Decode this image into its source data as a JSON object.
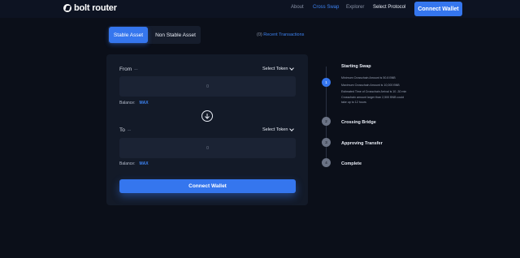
{
  "header": {
    "logo_text": "bolt router",
    "nav": {
      "about": "About",
      "cross_swap": "Cross Swap",
      "explorer": "Explorer",
      "select_protocol": "Select Protocol"
    },
    "connect_wallet": "Connect Wallet"
  },
  "tabs": {
    "stable": "Stable Asset",
    "non_stable": "Non Stable Asset"
  },
  "recent": {
    "count": "(0)",
    "label": "Recent Transactions"
  },
  "swap": {
    "from_label": "From",
    "from_value": "--",
    "from_token": "Select Token",
    "from_amount_placeholder": "0",
    "from_balance_label": "Balance:",
    "from_max": "MAX",
    "to_label": "To",
    "to_value": "--",
    "to_token": "Select Token",
    "to_amount_placeholder": "0",
    "to_balance_label": "Balance:",
    "to_max": "MAX",
    "connect_wallet": "Connect Wallet"
  },
  "steps": [
    {
      "number": "1",
      "title": "Starting Swap",
      "active": true
    },
    {
      "number": "2",
      "title": "Crossing Bridge",
      "active": false
    },
    {
      "number": "3",
      "title": "Approving Transfer",
      "active": false
    },
    {
      "number": "4",
      "title": "Complete",
      "active": false
    }
  ],
  "step_details": [
    "Minimum Crosschain Amount is 50.8 BNB",
    "Maximum Crosschain Amount is 10,000 BNB",
    "Estimated Time of Crosschain Arrival is 10 -30 min",
    "Crosschain amount larger than 2,500 BNB could",
    "take up to 12 hours"
  ],
  "colors": {
    "accent": "#3576ee",
    "background": "#0b0f19",
    "card": "#131a28"
  }
}
